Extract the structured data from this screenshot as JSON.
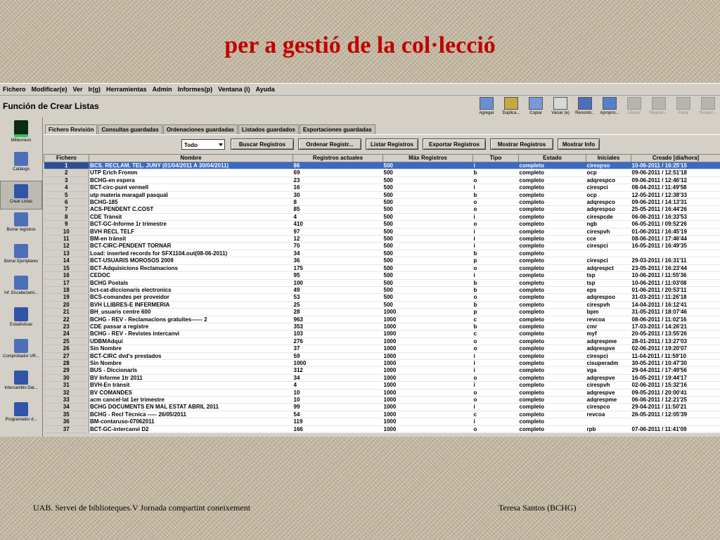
{
  "slide": {
    "title": "per a gestió de la col·lecció",
    "footer_left": "UAB. Servei de biblioteques.V Jornada compartint coneixement",
    "footer_right": "Teresa Santos (BCHG)"
  },
  "menu": [
    "Fichero",
    "Modificar(e)",
    "Ver",
    "Ir(g)",
    "Herramientas",
    "Admin",
    "Informes(p)",
    "Ventana (i)",
    "Ayuda"
  ],
  "function_title": "Función de Crear Listas",
  "toolbar": [
    {
      "label": "Agregar",
      "icon": "add-icon",
      "enabled": true
    },
    {
      "label": "Duplica...",
      "icon": "duplicate-icon",
      "enabled": true
    },
    {
      "label": "Copiar",
      "icon": "copy-icon",
      "enabled": true
    },
    {
      "label": "Vaciar (e)",
      "icon": "empty-icon",
      "enabled": true
    },
    {
      "label": "Renomb...",
      "icon": "rename-icon",
      "enabled": true
    },
    {
      "label": "Apropris...",
      "icon": "appropriate-icon",
      "enabled": true
    },
    {
      "label": "Liberar",
      "icon": "release-icon",
      "enabled": false
    },
    {
      "label": "Reanun...",
      "icon": "resume-icon",
      "enabled": false
    },
    {
      "label": "Parar",
      "icon": "stop-icon",
      "enabled": false
    },
    {
      "label": "Suspen...",
      "icon": "suspend-icon",
      "enabled": false
    }
  ],
  "sidebar": [
    {
      "label": "Millennium",
      "icon": "millennium-logo-icon"
    },
    {
      "label": "Catálogo",
      "icon": "catalog-icon"
    },
    {
      "label": "Crear Listas",
      "icon": "create-lists-icon",
      "active": true
    },
    {
      "label": "Borrar registros",
      "icon": "delete-records-icon"
    },
    {
      "label": "Borrar Ejemplares",
      "icon": "delete-items-icon"
    },
    {
      "label": "Inf. Encabezami...",
      "icon": "headings-report-icon"
    },
    {
      "label": "Estadísticas",
      "icon": "statistics-icon"
    },
    {
      "label": "Comprobador UR...",
      "icon": "url-checker-icon"
    },
    {
      "label": "Intercambio Dat...",
      "icon": "data-exchange-icon"
    },
    {
      "label": "Programador d...",
      "icon": "scheduler-icon"
    }
  ],
  "tabs": [
    "Fichero Revisión",
    "Consultas guardadas",
    "Ordenaciones guardadas",
    "Listados guardados",
    "Exportaciones guardadas"
  ],
  "filter_select": "Todo",
  "actions": [
    "Buscar Registros",
    "Ordenar Registr...",
    "Listar Registros",
    "Exportar Registros",
    "Mostrar Registros",
    "Mostrar Info"
  ],
  "columns": [
    "Fichero",
    "Nombre",
    "Registros actuales",
    "Máx Registros",
    "Tipo",
    "Estado",
    "Iniciales",
    "Creado [día/hora]"
  ],
  "rows": [
    [
      "1",
      "BCS. RECLAM. TEL. JUNY (01/04/2011 A 30/04/2011)",
      "86",
      "500",
      "i",
      "completo",
      "cirespso",
      "10-06-2011 / 16:25'15"
    ],
    [
      "2",
      "UTP Erich Fromm",
      "69",
      "500",
      "b",
      "completo",
      "ocp",
      "09-06-2011 / 12:51'18"
    ],
    [
      "3",
      "BCHG-en espera",
      "23",
      "500",
      "o",
      "completo",
      "adqrespco",
      "09-06-2011 / 12:46'12"
    ],
    [
      "4",
      "BCT-circ-punt vermell",
      "16",
      "500",
      "i",
      "completo",
      "cirespci",
      "08-04-2011 / 11:49'58"
    ],
    [
      "5",
      "utp materia maragall pasqual",
      "30",
      "500",
      "b",
      "completo",
      "ocp",
      "12-05-2011 / 12:38'33"
    ],
    [
      "6",
      "BCHG-185",
      "8",
      "500",
      "o",
      "completo",
      "adqrespco",
      "09-06-2011 / 14:13'31"
    ],
    [
      "7",
      "ACS-PENDENT C.COST",
      "85",
      "500",
      "o",
      "completo",
      "adqrespso",
      "25-05-2011 / 16:44'26"
    ],
    [
      "8",
      "CDE Trànsit",
      "4",
      "500",
      "i",
      "completo",
      "cirespcde",
      "06-06-2011 / 16:33'53"
    ],
    [
      "9",
      "BCT-GC-Informe 1r trimestre",
      "410",
      "500",
      "o",
      "completo",
      "ngb",
      "06-05-2011 / 09:52'26"
    ],
    [
      "10",
      "BVH RECL TELF",
      "97",
      "500",
      "i",
      "completo",
      "cirespvh",
      "01-06-2011 / 16:45'19"
    ],
    [
      "11",
      "BM-en trànsit",
      "12",
      "500",
      "i",
      "completo",
      "cce",
      "08-06-2011 / 17:46'44"
    ],
    [
      "12",
      "BCT-CIRC-PENDENT TORNAR",
      "70",
      "500",
      "i",
      "completo",
      "cirespci",
      "16-05-2011 / 16:49'35"
    ],
    [
      "13",
      "Load: inserted records for SFX1104.out(08-06-2011)",
      "34",
      "500",
      "b",
      "completo",
      "",
      ""
    ],
    [
      "14",
      "BCT-USUARIS MOROSOS 2009",
      "36",
      "500",
      "p",
      "completo",
      "cirespci",
      "29-03-2011 / 16:31'11"
    ],
    [
      "15",
      "BCT-Adquisicions Reclamacions",
      "175",
      "500",
      "o",
      "completo",
      "adqrespct",
      "23-05-2011 / 16:23'44"
    ],
    [
      "16",
      "CEDOC",
      "95",
      "500",
      "i",
      "completo",
      "tsp",
      "10-06-2011 / 11:55'36"
    ],
    [
      "17",
      "BCHG Postals",
      "100",
      "500",
      "b",
      "completo",
      "tsp",
      "10-06-2011 / 11:03'08"
    ],
    [
      "18",
      "bct-cat-diccionaris electronics",
      "49",
      "500",
      "b",
      "completo",
      "eps",
      "01-06-2011 / 20:53'11"
    ],
    [
      "19",
      "BCS-comandes per proveidor",
      "53",
      "500",
      "o",
      "completo",
      "adqrespso",
      "31-03-2011 / 11:26'18"
    ],
    [
      "20",
      "BVH LLIBRES-E INFERMERIA",
      "25",
      "500",
      "b",
      "completo",
      "cirespvh",
      "14-04-2011 / 16:12'41"
    ],
    [
      "21",
      "BH_usuaris centre 600",
      "28",
      "1000",
      "p",
      "completo",
      "bpm",
      "31-05-2011 / 18:07'46"
    ],
    [
      "22",
      "BCHG - REV - Reclamacions gratuites------ 2",
      "963",
      "1000",
      "c",
      "completo",
      "revcoa",
      "08-06-2011 / 11:02'16"
    ],
    [
      "23",
      "CDE passar a registre",
      "353",
      "1000",
      "b",
      "completo",
      "cmr",
      "17-03-2011 / 14:26'21"
    ],
    [
      "24",
      "BCHG - REV - Revistes intercanvi",
      "103",
      "1000",
      "c",
      "completo",
      "myf",
      "20-05-2011 / 13:55'26"
    ],
    [
      "25",
      "UDBMAdqui",
      "276",
      "1000",
      "o",
      "completo",
      "adqrespme",
      "28-01-2011 / 13:27'03"
    ],
    [
      "26",
      "Sin Nombre",
      "37",
      "1000",
      "o",
      "completo",
      "adqrespve",
      "02-06-2011 / 19:20'07"
    ],
    [
      "27",
      "BCT-CIRC dvd's prestados",
      "59",
      "1000",
      "i",
      "completo",
      "cirespci",
      "11-04-2011 / 11:59'10"
    ],
    [
      "28",
      "Sin Nombre",
      "1000",
      "1000",
      "i",
      "completo",
      "cisuperadm",
      "30-05-2011 / 10:47'30"
    ],
    [
      "29",
      "BUS - Diccionaris",
      "312",
      "1000",
      "i",
      "completo",
      "vga",
      "29-04-2011 / 17:49'56"
    ],
    [
      "30",
      "BV Informe 1tr 2011",
      "34",
      "1000",
      "o",
      "completo",
      "adqrespve",
      "16-05-2011 / 19:44'17"
    ],
    [
      "31",
      "BVH-En trànsit",
      "4",
      "1000",
      "i",
      "completo",
      "cirespvh",
      "02-06-2011 / 15:32'16"
    ],
    [
      "32",
      "BV COMANDES",
      "10",
      "1000",
      "o",
      "completo",
      "adqrespve",
      "09-05-2011 / 20:00'41"
    ],
    [
      "33",
      "acm cancel·lat 1er trimestre",
      "10",
      "1000",
      "o",
      "completo",
      "adqrespme",
      "06-06-2011 / 12:21'25"
    ],
    [
      "34",
      "BCHG DOCUMENTS EN MAL ESTAT ABRIL 2011",
      "99",
      "1000",
      "i",
      "completo",
      "cirespco",
      "29-04-2011 / 11:50'21"
    ],
    [
      "35",
      "BCHG - Recl Tècnica ----- 26/05/2011",
      "54",
      "1000",
      "c",
      "completo",
      "revcoa",
      "26-05-2011 / 12:05'39"
    ],
    [
      "36",
      "BM-contaruso-07062011",
      "119",
      "1000",
      "i",
      "completo",
      "",
      ""
    ],
    [
      "37",
      "BCT-GC-intercanvi D2",
      "166",
      "1000",
      "o",
      "completo",
      "rpb",
      "07-06-2011 / 11:41'09"
    ]
  ]
}
